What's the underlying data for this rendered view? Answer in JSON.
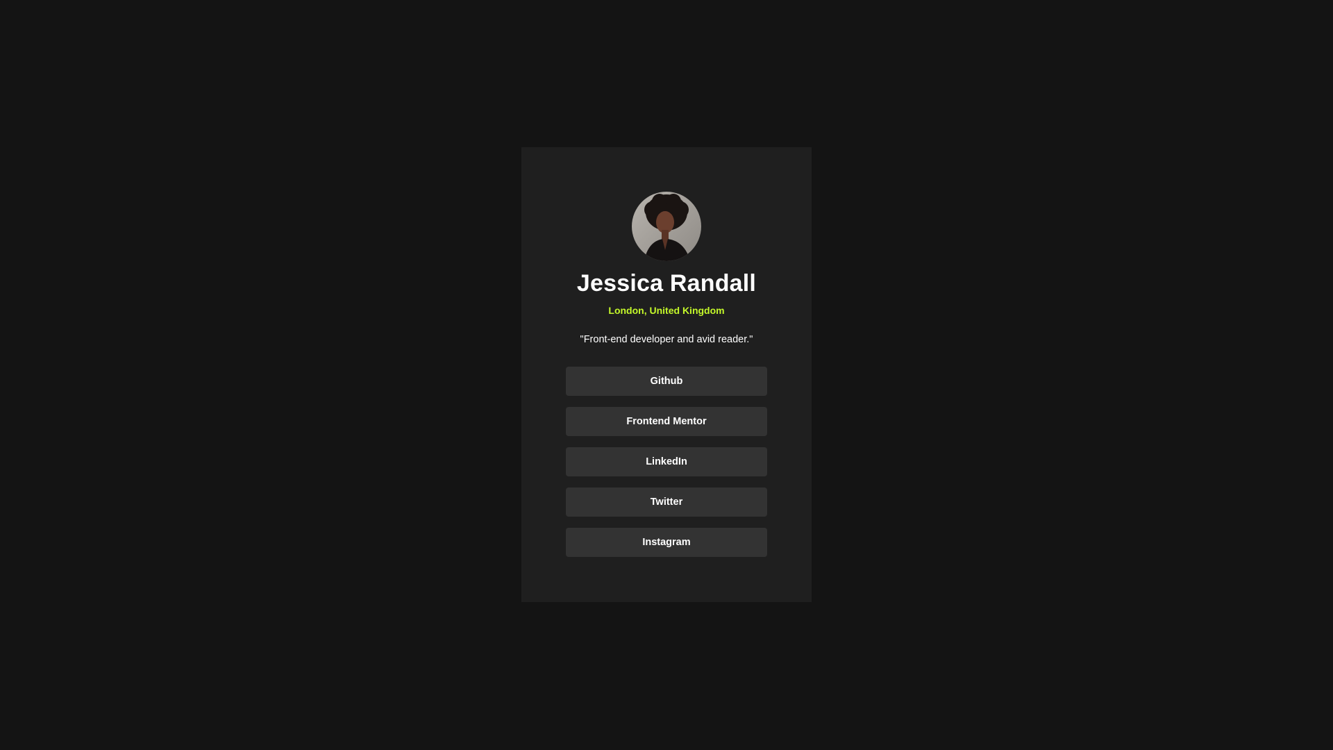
{
  "profile": {
    "name": "Jessica Randall",
    "location": "London, United Kingdom",
    "bio": "\"Front-end developer and avid reader.\""
  },
  "links": [
    {
      "label": "Github"
    },
    {
      "label": "Frontend Mentor"
    },
    {
      "label": "LinkedIn"
    },
    {
      "label": "Twitter"
    },
    {
      "label": "Instagram"
    }
  ],
  "colors": {
    "page_background": "#141414",
    "card_background": "#1f1f1f",
    "button_background": "#333333",
    "accent": "#c4f82a",
    "text": "#ffffff"
  }
}
